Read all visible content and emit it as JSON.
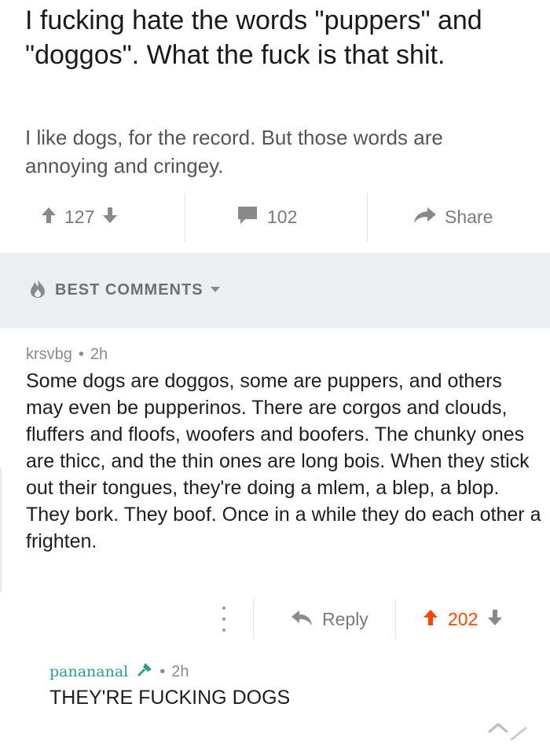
{
  "post": {
    "title": "I fucking hate the words \"puppers\" and \"doggos\". What the fuck is that shit.",
    "body": "I like dogs, for the record. But those words are annoying and cringey.",
    "votes": "127",
    "comments": "102",
    "share_label": "Share"
  },
  "sort": {
    "label": "BEST COMMENTS"
  },
  "comment": {
    "author": "krsvbg",
    "age": "2h",
    "body": "Some dogs are doggos, some are puppers, and others may even be pupperinos. There are corgos and clouds, fluffers and floofs, woofers and boofers. The chunky ones are thicc, and the thin ones are long bois. When they stick out their tongues, they're doing a mlem, a blep, a blop. They bork. They boof. Once in a while they do each other a frighten.",
    "reply_label": "Reply",
    "votes": "202"
  },
  "reply": {
    "author": "panananal",
    "age": "2h",
    "body": "THEY'RE FUCKING DOGS"
  },
  "icons": {
    "upvote": "arrow-up-icon",
    "downvote": "arrow-down-icon",
    "comments": "comment-bubble-icon",
    "share": "share-arrow-icon",
    "sort": "flame-icon",
    "dropdown": "caret-down-icon",
    "more": "more-vertical-icon",
    "reply": "reply-arrow-icon",
    "flair": "microphone-icon"
  },
  "colors": {
    "accent_upvote": "#ff4500",
    "username_teal": "#2a9d8f",
    "sort_band": "#eceff2",
    "muted_text": "#7a7a7a"
  }
}
